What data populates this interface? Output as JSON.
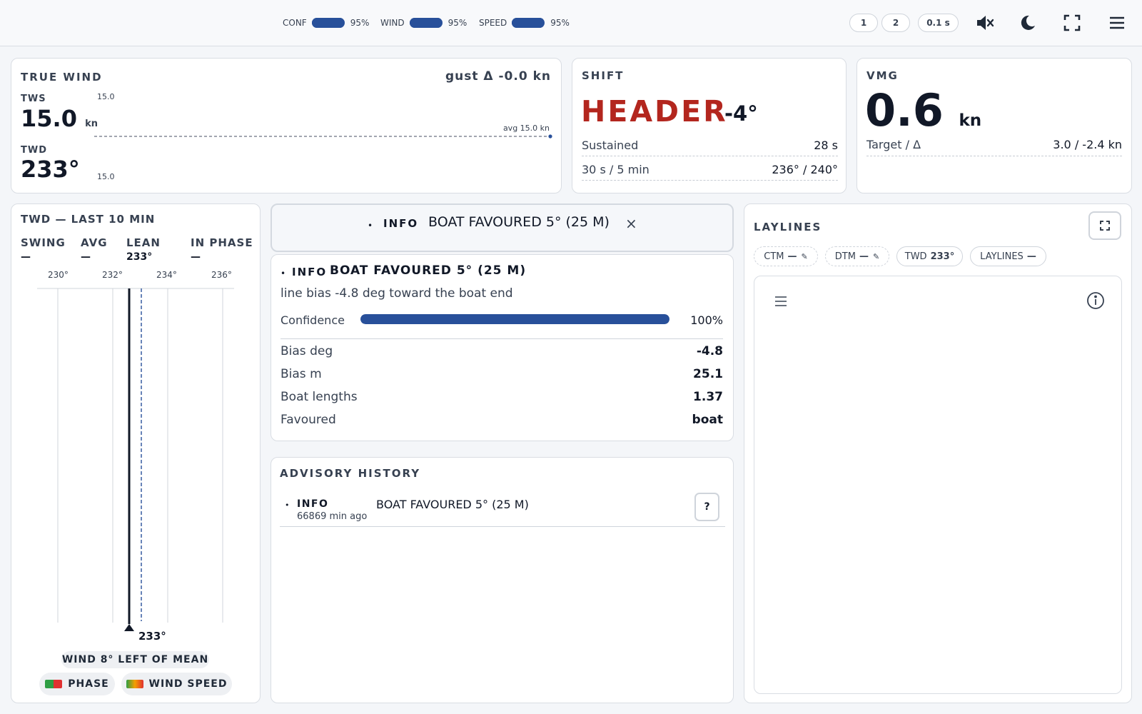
{
  "topbar": {
    "confidence": [
      {
        "label": "CONF",
        "value": "95%",
        "fraction": 0.95
      },
      {
        "label": "WIND",
        "value": "95%",
        "fraction": 0.95
      },
      {
        "label": "SPEED",
        "value": "95%",
        "fraction": 0.95
      }
    ],
    "buttons": [
      "1",
      "2",
      "0.1 s"
    ],
    "icons": [
      "mute-icon",
      "moon-icon",
      "fullscreen-icon",
      "menu-icon"
    ]
  },
  "true_wind": {
    "title": "TRUE WIND",
    "gust": "gust Δ -0.0 kn",
    "tws_label": "TWS",
    "tws_value": "15.0",
    "tws_unit": "kn",
    "twd_label": "TWD",
    "twd_value": "233°",
    "chart_top": "15.0",
    "chart_bottom": "15.0",
    "avg_label": "avg 15.0 kn"
  },
  "shift": {
    "title": "SHIFT",
    "state": "HEADER",
    "degrees": "-4°",
    "sustained_label": "Sustained",
    "sustained_value": "28 s",
    "window_label": "30 s / 5 min",
    "window_value": "236° / 240°"
  },
  "vmg": {
    "title": "VMG",
    "value": "0.6",
    "unit": "kn",
    "target_label": "Target / Δ",
    "target_value": "3.0 / -2.4 kn"
  },
  "twd_history": {
    "title": "TWD — LAST 10 MIN",
    "headers": [
      "SWING",
      "AVG",
      "LEAN",
      "IN PHASE"
    ],
    "values": [
      "—",
      "—",
      "233°",
      "—"
    ],
    "ticks": [
      "230°",
      "232°",
      "234°",
      "236°"
    ],
    "current_label": "233°",
    "advice": "WIND 8° LEFT OF MEAN",
    "legend": [
      "PHASE",
      "WIND SPEED"
    ]
  },
  "banner": {
    "level": "INFO",
    "message": "BOAT FAVOURED 5° (25 M)",
    "close": "×"
  },
  "advisory_detail": {
    "level": "INFO",
    "title": "BOAT FAVOURED 5° (25 M)",
    "description": "line bias -4.8 deg toward the boat end",
    "confidence_label": "Confidence",
    "confidence_value": "100%",
    "confidence_fraction": 1.0,
    "rows": [
      {
        "label": "Bias deg",
        "value": "-4.8"
      },
      {
        "label": "Bias m",
        "value": "25.1"
      },
      {
        "label": "Boat lengths",
        "value": "1.37"
      },
      {
        "label": "Favoured",
        "value": "boat"
      }
    ]
  },
  "advisory_history": {
    "title": "ADVISORY HISTORY",
    "items": [
      {
        "level": "INFO",
        "time": "66869 min ago",
        "message": "BOAT FAVOURED 5° (25 M)",
        "help": "?"
      }
    ]
  },
  "laylines": {
    "title": "LAYLINES",
    "chips": [
      {
        "label": "CTM",
        "value": "—"
      },
      {
        "label": "DTM",
        "value": "—"
      },
      {
        "label": "TWD",
        "value": "233°"
      },
      {
        "label": "LAYLINES",
        "value": "—"
      }
    ]
  }
}
